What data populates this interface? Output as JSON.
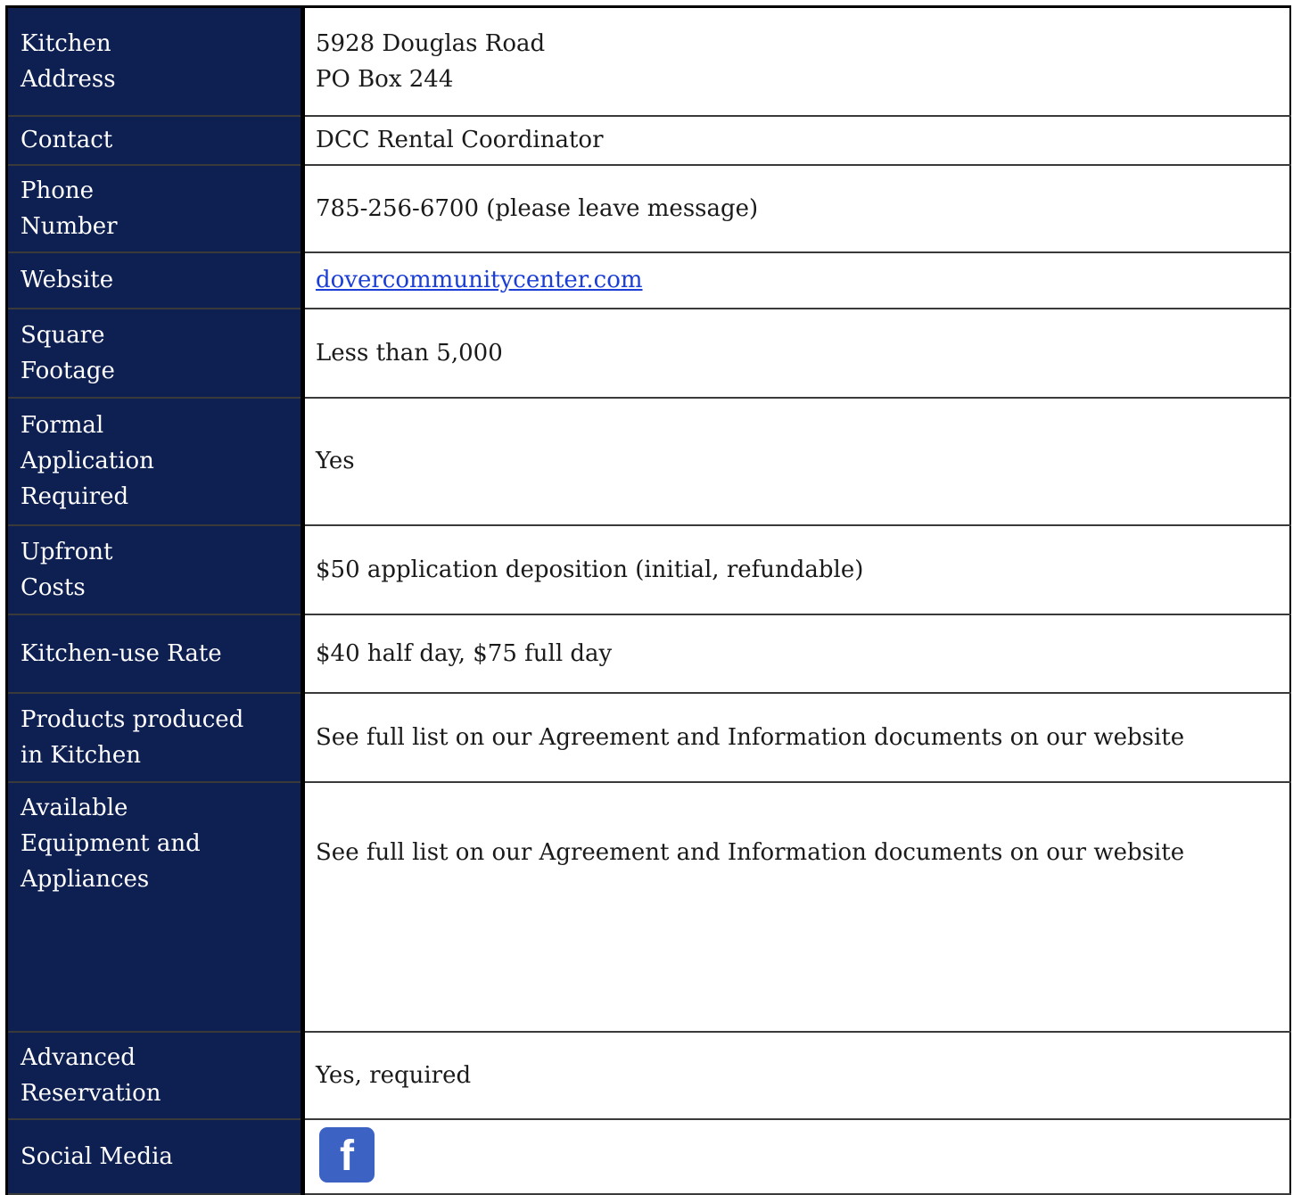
{
  "rows": [
    {
      "label": "Kitchen\nAddress",
      "value": "5928 Douglas Road\nPO Box 244"
    },
    {
      "label": "Contact",
      "value": "DCC Rental Coordinator"
    },
    {
      "label": "Phone\nNumber",
      "value": "785-256-6700 (please leave message)"
    },
    {
      "label": "Website",
      "value": "dovercommunitycenter.com"
    },
    {
      "label": "Square\nFootage",
      "value": "Less than 5,000"
    },
    {
      "label": "Formal\nApplication\nRequired",
      "value": "Yes"
    },
    {
      "label": "Upfront\nCosts",
      "value": "$50 application deposition (initial, refundable)"
    },
    {
      "label": "Kitchen-use Rate",
      "value": "$40 half day, $75 full day"
    },
    {
      "label": "Products produced\nin Kitchen",
      "value": "See full list on our Agreement and Information documents on our website"
    },
    {
      "label": "Available\nEquipment and\nAppliances",
      "value": "See full list on our Agreement and Information documents on our website"
    },
    {
      "label": "Advanced\nReservation",
      "value": "Yes, required"
    },
    {
      "label": "Social Media",
      "icon": "facebook-icon",
      "icon_glyph": "f"
    }
  ],
  "colors": {
    "label_bg": "#0e1f52",
    "link": "#1a3ed6",
    "facebook": "#3c63c4"
  }
}
